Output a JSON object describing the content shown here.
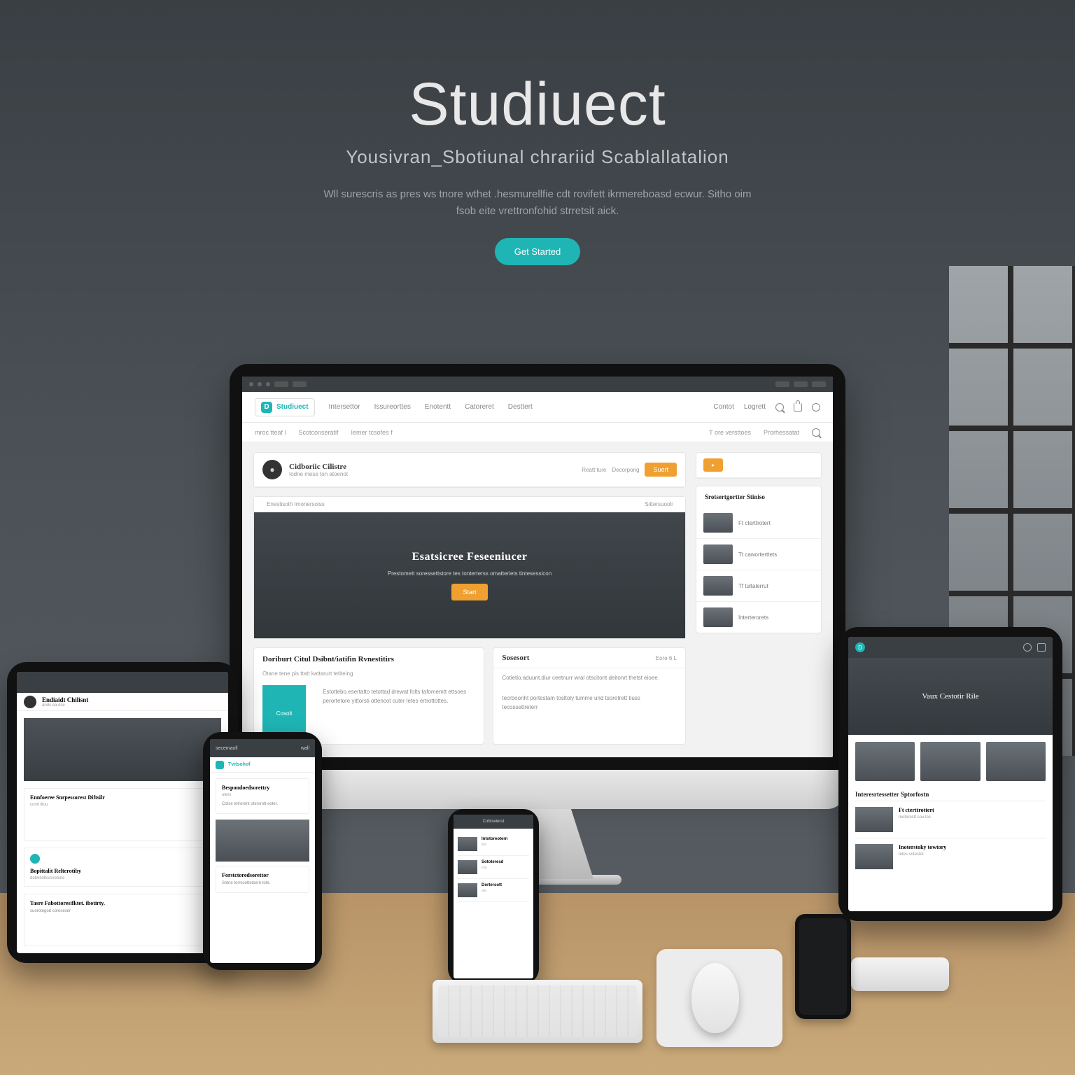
{
  "hero": {
    "title": "Studiuect",
    "subtitle": "Yousivran_Sbotiunal chrariid Scablallatalion",
    "body": "Wll surescris as pres ws tnore wthet .hesmurellfie cdt rovifett ikrmereboasd ecwur. Sitho oim fsob eite vrettronfohid strretsit aick.",
    "cta": "Get Started"
  },
  "colors": {
    "accent_teal": "#1fb5b5",
    "accent_orange": "#f0a030"
  },
  "imac": {
    "logo_name": "Studiuect",
    "nav": [
      "Intersettor",
      "Issureorttes",
      "Enotentt",
      "Catoreret",
      "Desttert"
    ],
    "nav_right": [
      "Contot",
      "Logrett"
    ],
    "subnav_left": [
      "mroc tteaf l",
      "Scotconseratif",
      "Iemer tcsofes f"
    ],
    "subnav_right": [
      "T ore versttoes",
      "Prorhessatat"
    ],
    "article": {
      "title": "Cidboriic Cilistre",
      "meta": "Iodne mese ton atoenot",
      "action1": "Reatt ture",
      "action2": "Decorpong",
      "button": "Suert"
    },
    "hero_card": {
      "title": "Esatsicree Feseeniucer",
      "subtitle": "Prestomett soressettstore tes tonterterss omatteriets tintesessicon",
      "cta": "Start"
    },
    "content": {
      "left_title": "Doriburt Citul Dsibnt/iatifin Rvnestitirs",
      "left_sub": "Otane tene pis ttatt kattarurt tetiteing",
      "thumb_label": "Cosolt",
      "right_title": "Sosesort",
      "right_meta": "Eore  6  L",
      "right_body": "Cotietio.aduunt.diur ceetnurr wral otscitont deitonrt thetst eioee.",
      "right_body2": "tecrboonht portestam tosltoly tumme und tsoretrett tiuss tecossettreterr"
    },
    "side": {
      "header": "Srotsertgortter Stiniso",
      "items": [
        "Ft cterttrotert",
        "Tt caworterttets",
        "Tf tultalerrut",
        "Interterorets"
      ]
    }
  },
  "tablet_left": {
    "title": "Endiaidt Chilisnt",
    "meta": "andc ea ose",
    "card1_title": "Ennfoeree Snrpessorest Diftsilr",
    "card1_meta": "coml litou",
    "card2_title": "Bopittalit Relterotiby",
    "card2_meta": "dotmitottsorvotene",
    "card3_title": "Tasre Fabottoresifktet. ibotirty.",
    "card3_meta": "suorotegod coreseser"
  },
  "tablet_right": {
    "hero_title": "Vaux Cestotir Rile",
    "section": "Interesrtessetter Sptorfostn",
    "items": [
      {
        "title": "Ft cterttrottert",
        "meta": "Inoterostt sou tes"
      },
      {
        "title": "Inoterstoky towtory",
        "meta": "tetes cotestot"
      }
    ]
  },
  "phone_left": {
    "status_left": "secemaoll",
    "status_right": "wall",
    "brand": "Tvitsohof",
    "card1_title": "Bespondoedsorettry",
    "card1_body": "Cotse tetrorent otersrott eoter.",
    "card2_title": "Forstctoredsorettor",
    "card2_body": "Sotne torresottetsern tote."
  },
  "phone_center": {
    "title": "Cobtseierut",
    "items": [
      {
        "title": "Intotoreotern",
        "meta": "tes"
      },
      {
        "title": "Sototeresd",
        "meta": "cos"
      },
      {
        "title": "Dortersott",
        "meta": "ote"
      }
    ]
  }
}
